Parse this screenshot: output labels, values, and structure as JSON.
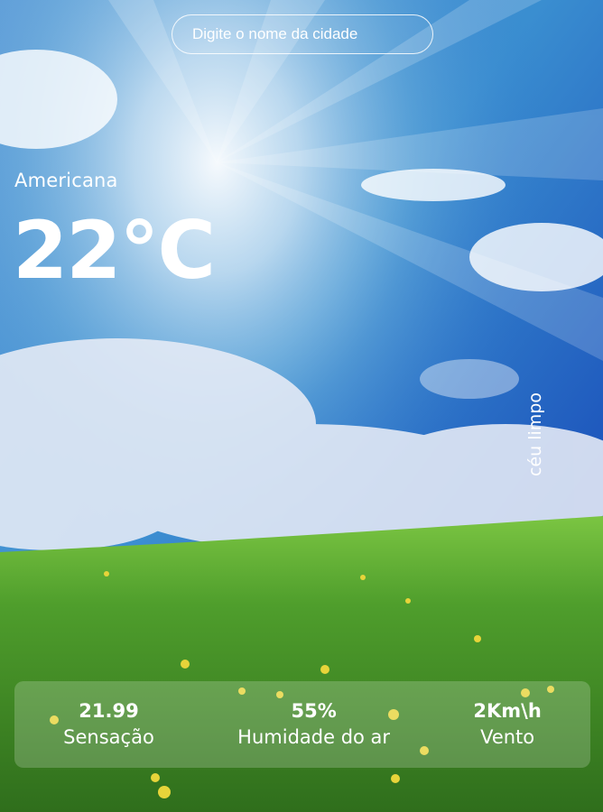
{
  "search": {
    "placeholder": "Digite o nome da cidade"
  },
  "weather": {
    "city": "Americana",
    "temperature": "22°C",
    "description": "céu limpo"
  },
  "metrics": [
    {
      "value": "21.99",
      "label": "Sensação"
    },
    {
      "value": "55%",
      "label": "Humidade do ar"
    },
    {
      "value": "2Km\\h",
      "label": "Vento"
    }
  ],
  "background": {
    "scene": "sunny sky over grass field"
  }
}
